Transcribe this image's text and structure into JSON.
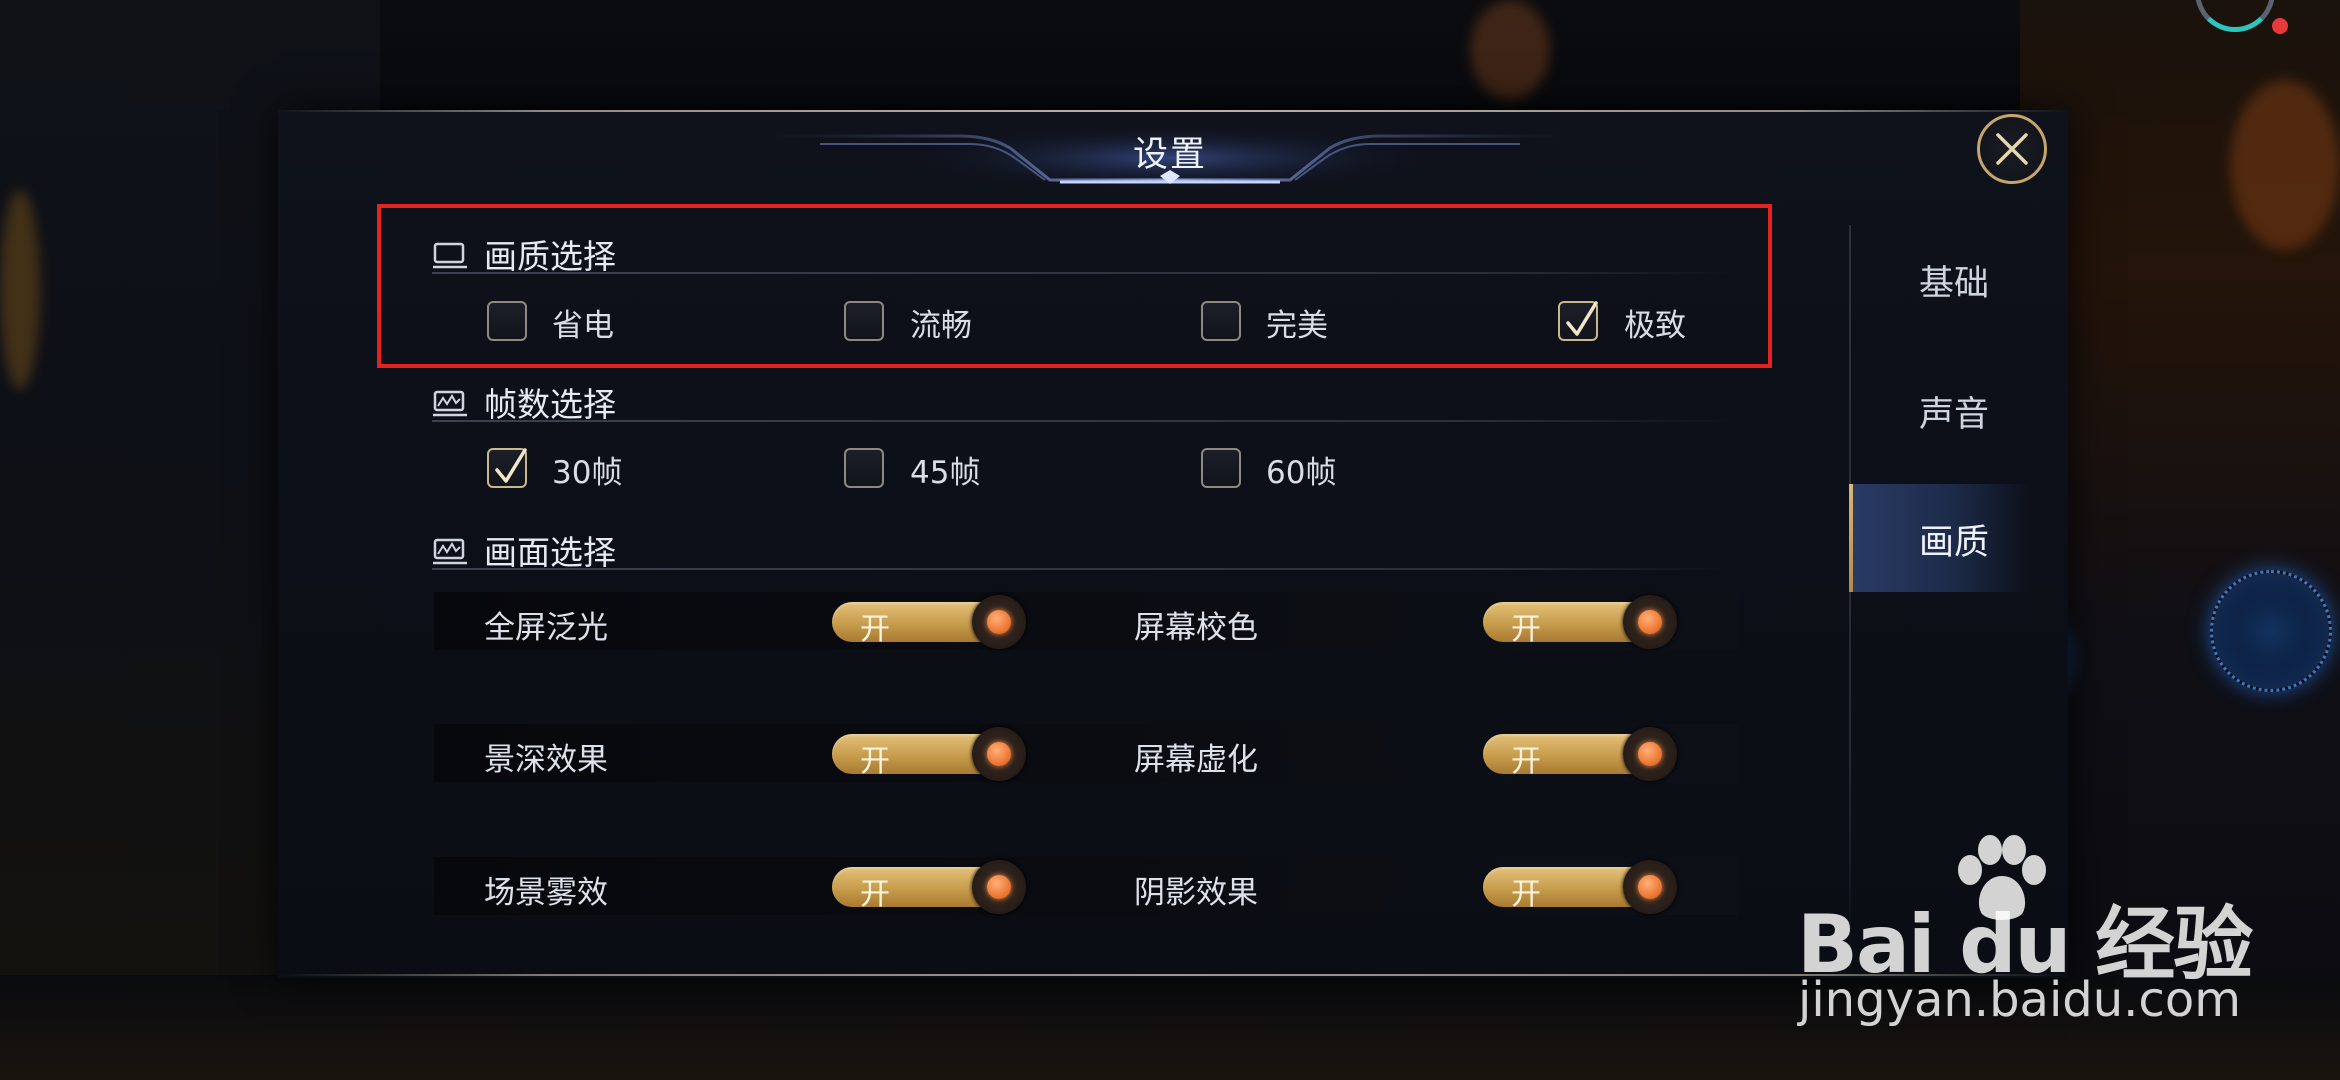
{
  "dialog": {
    "title": "设置",
    "close_icon": "close-icon"
  },
  "sections": {
    "quality": {
      "title": "画质选择",
      "icon": "monitor-icon",
      "options": [
        {
          "label": "省电",
          "checked": false
        },
        {
          "label": "流畅",
          "checked": false
        },
        {
          "label": "完美",
          "checked": false
        },
        {
          "label": "极致",
          "checked": true
        }
      ]
    },
    "framerate": {
      "title": "帧数选择",
      "icon": "chart-icon",
      "options": [
        {
          "label": "30帧",
          "checked": true
        },
        {
          "label": "45帧",
          "checked": false
        },
        {
          "label": "60帧",
          "checked": false
        }
      ]
    },
    "display": {
      "title": "画面选择",
      "icon": "chart-icon",
      "toggles": [
        {
          "label": "全屏泛光",
          "state": "开"
        },
        {
          "label": "屏幕校色",
          "state": "开"
        },
        {
          "label": "景深效果",
          "state": "开"
        },
        {
          "label": "屏幕虚化",
          "state": "开"
        },
        {
          "label": "场景雾效",
          "state": "开"
        },
        {
          "label": "阴影效果",
          "state": "开"
        }
      ]
    }
  },
  "side_tabs": [
    {
      "label": "基础",
      "active": false
    },
    {
      "label": "声音",
      "active": false
    },
    {
      "label": "画质",
      "active": true
    }
  ],
  "watermark": {
    "brand": "Bai du 经验",
    "url": "jingyan.baidu.com"
  },
  "colors": {
    "highlight_border": "#e4231f",
    "toggle_gold": "#d4ad62",
    "knob_orange": "#ee7a35",
    "active_tab": "#2a3b64"
  }
}
